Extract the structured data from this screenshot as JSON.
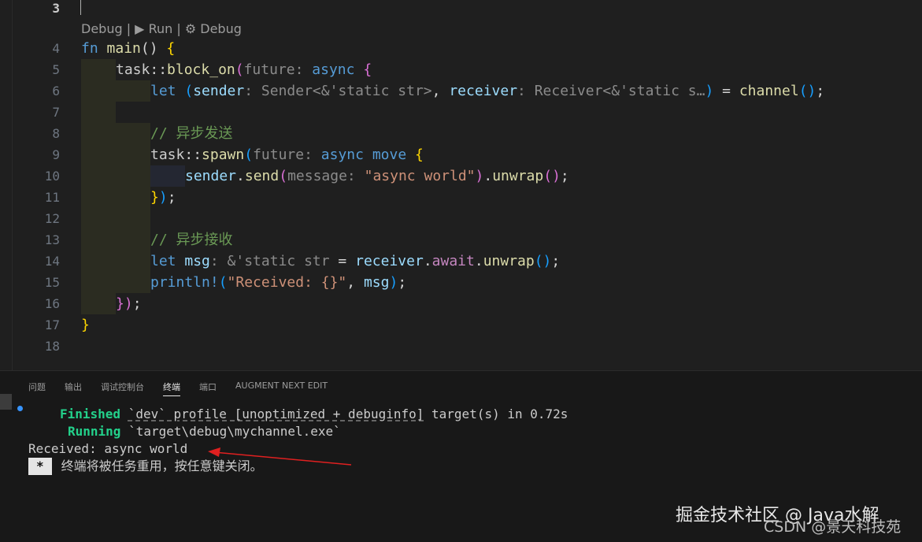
{
  "codelens": "Debug | ▶ Run | ⚙ Debug",
  "code_lines": [
    {
      "n": "3"
    },
    {
      "n": "4"
    },
    {
      "n": "5"
    },
    {
      "n": "6"
    },
    {
      "n": "7"
    },
    {
      "n": "8"
    },
    {
      "n": "9"
    },
    {
      "n": "10"
    },
    {
      "n": "11"
    },
    {
      "n": "12"
    },
    {
      "n": "13"
    },
    {
      "n": "14"
    },
    {
      "n": "15"
    },
    {
      "n": "16"
    },
    {
      "n": "17"
    },
    {
      "n": "18"
    }
  ],
  "code": {
    "l4": {
      "kw": "fn",
      "name": "main",
      "rest": "() ",
      "brace": "{"
    },
    "l5": {
      "ns": "task",
      "sep": "::",
      "fn": "block_on",
      "open": "(",
      "hint": "future:",
      "kw": "async",
      "brace": "{"
    },
    "l6": {
      "kw": "let",
      "open": "(",
      "v1": "sender",
      "h1": ": Sender<&'static str>",
      "comma": ",",
      "v2": "receiver",
      "h2": ": Receiver<&'static s…",
      "close": ")",
      "eq": " = ",
      "fn": "channel",
      "call": "()",
      "semi": ";"
    },
    "l8": {
      "comment": "// 异步发送"
    },
    "l9": {
      "ns": "task",
      "sep": "::",
      "fn": "spawn",
      "open": "(",
      "hint": "future:",
      "kw1": "async",
      "kw2": "move",
      "brace": "{"
    },
    "l10": {
      "v": "sender",
      "dot": ".",
      "fn": "send",
      "open": "(",
      "hint": "message:",
      "str": "\"async world\"",
      "close": ")",
      "dot2": ".",
      "fn2": "unwrap",
      "call": "()",
      "semi": ";"
    },
    "l11": {
      "brace": "}",
      "close": ")",
      "semi": ";"
    },
    "l13": {
      "comment": "// 异步接收"
    },
    "l14": {
      "kw": "let",
      "v": "msg",
      "hint": ": &'static str",
      "eq": " = ",
      "v2": "receiver",
      "dot": ".",
      "aw": "await",
      "dot2": ".",
      "fn": "unwrap",
      "call": "()",
      "semi": ";"
    },
    "l15": {
      "mac": "println!",
      "open": "(",
      "str": "\"Received: {}\"",
      "comma": ", ",
      "v": "msg",
      "close": ")",
      "semi": ";"
    },
    "l16": {
      "brace": "}",
      "close": ")",
      "semi": ";"
    },
    "l17": {
      "brace": "}"
    }
  },
  "panel": {
    "tabs": [
      "问题",
      "输出",
      "调试控制台",
      "终端",
      "端口",
      "AUGMENT NEXT EDIT"
    ],
    "active_tab": "终端"
  },
  "terminal": {
    "l1_status": "Finished",
    "l1_profile": "`dev` profile [unoptimized + debuginfo]",
    "l1_rest": " target(s) in 0.72s",
    "l2_status": "Running",
    "l2_path": " `target\\debug\\mychannel.exe`",
    "l3": "Received: async world",
    "l4_badge": "*",
    "l4_text": "终端将被任务重用，按任意键关闭。"
  },
  "watermark": {
    "main": "掘金技术社区 @ Java水解",
    "sub": "CSDN @景天科技苑"
  },
  "colors": {
    "accent": "#3794ff",
    "arrow": "#e02020",
    "green": "#23d18b"
  }
}
